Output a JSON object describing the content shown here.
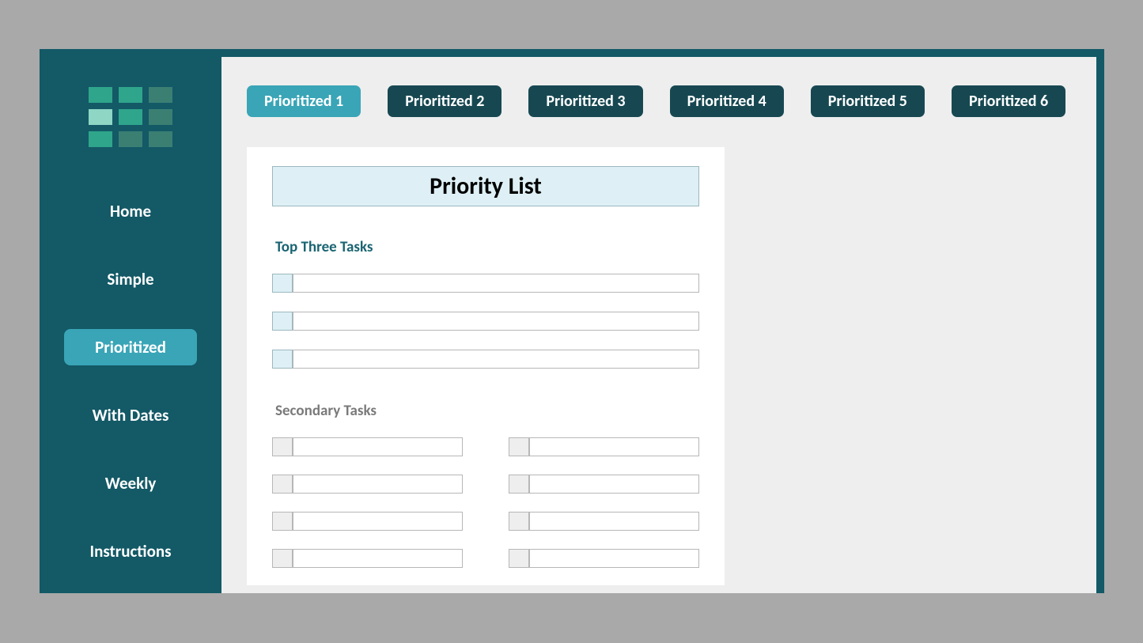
{
  "sidebar": {
    "items": [
      {
        "label": "Home"
      },
      {
        "label": "Simple"
      },
      {
        "label": "Prioritized"
      },
      {
        "label": "With Dates"
      },
      {
        "label": "Weekly"
      },
      {
        "label": "Instructions"
      }
    ],
    "active_index": 2
  },
  "tabs": [
    {
      "label": "Prioritized 1"
    },
    {
      "label": "Prioritized 2"
    },
    {
      "label": "Prioritized 3"
    },
    {
      "label": "Prioritized 4"
    },
    {
      "label": "Prioritized 5"
    },
    {
      "label": "Prioritized 6"
    }
  ],
  "tabs_active_index": 0,
  "sheet": {
    "title": "Priority List",
    "section_top": "Top Three Tasks",
    "section_secondary": "Secondary Tasks",
    "top_tasks": [
      {
        "value": ""
      },
      {
        "value": ""
      },
      {
        "value": ""
      }
    ],
    "secondary_tasks": [
      {
        "value": ""
      },
      {
        "value": ""
      },
      {
        "value": ""
      },
      {
        "value": ""
      },
      {
        "value": ""
      },
      {
        "value": ""
      },
      {
        "value": ""
      },
      {
        "value": ""
      }
    ]
  }
}
